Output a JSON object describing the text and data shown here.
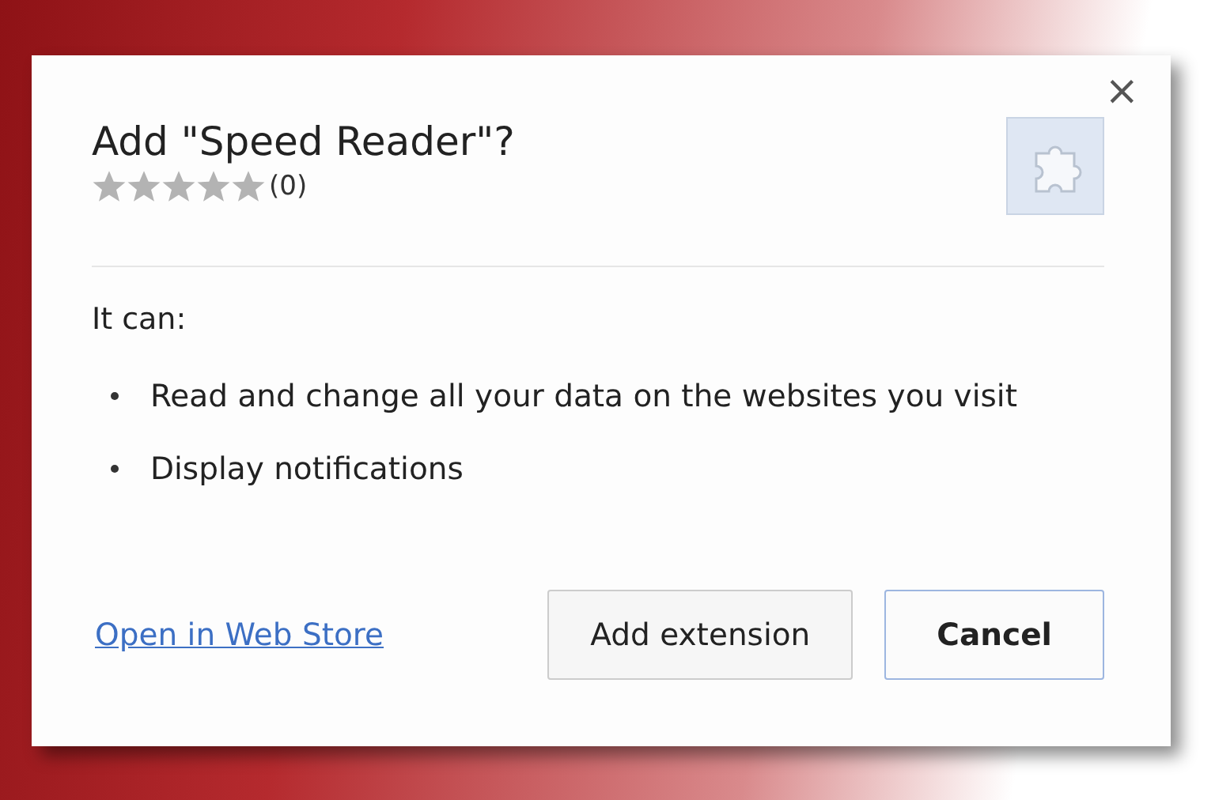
{
  "dialog": {
    "title": "Add \"Speed Reader\"?",
    "stars": 0,
    "rating_count": "(0)",
    "close": "×"
  },
  "permissions": {
    "heading": "It can:",
    "items": [
      "Read and change all your data on the websites you visit",
      "Display notifications"
    ]
  },
  "link": "Open in Web Store",
  "buttons": [
    {
      "label": "Add extension",
      "default": false
    },
    {
      "label": "Cancel",
      "default": true
    }
  ]
}
